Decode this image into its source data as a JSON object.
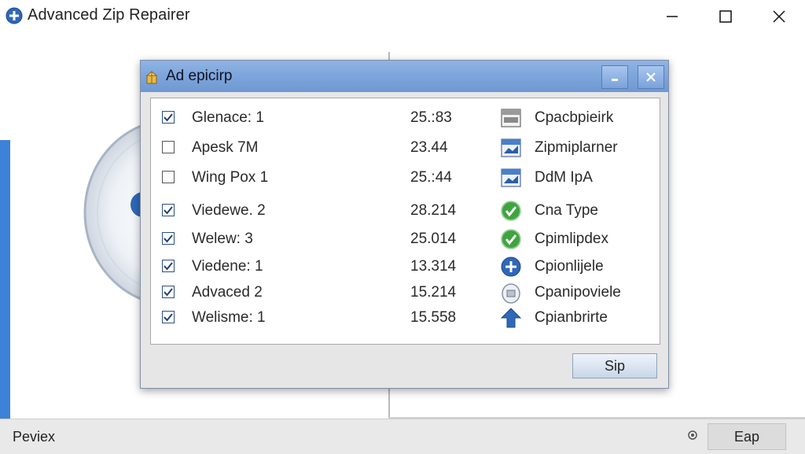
{
  "window": {
    "title": "Advanced Zip Repairer"
  },
  "statusbar": {
    "text": "Peviex",
    "button_label": "Eap"
  },
  "dialog": {
    "title": "Ad epicirp",
    "button_label": "Sip",
    "rows": [
      {
        "checked": true,
        "name": "Glenace: 1",
        "value": "25.:83",
        "icon": "document-gray-icon",
        "type": "Cpacbpieirk"
      },
      {
        "checked": false,
        "name": "Apesk 7M",
        "value": "23.44",
        "icon": "document-blue-icon",
        "type": "Zipmiplarner"
      },
      {
        "checked": false,
        "name": "Wing Pox 1",
        "value": "25.:44",
        "icon": "document-blue-icon",
        "type": "DdM IpA"
      },
      {
        "checked": true,
        "name": "Viedewe. 2",
        "value": "28.214",
        "icon": "check-green-icon",
        "type": "Cna Type"
      },
      {
        "checked": true,
        "name": "Welew: 3",
        "value": "25.014",
        "icon": "check-green-icon",
        "type": "Cpimlipdex"
      },
      {
        "checked": true,
        "name": "Viedene: 1",
        "value": "13.314",
        "icon": "plus-blue-icon",
        "type": "Cpionlijele"
      },
      {
        "checked": true,
        "name": "Advaced 2",
        "value": "15.214",
        "icon": "disc-gray-icon",
        "type": "Cpanipoviele"
      },
      {
        "checked": true,
        "name": "Welisme: 1",
        "value": "15.558",
        "icon": "arrow-up-blue-icon",
        "type": "Cpianbrirte"
      }
    ]
  },
  "colors": {
    "accent": "#3d82d8",
    "dialog_title": "#7fa6dc",
    "check_green": "#3ea53e"
  }
}
